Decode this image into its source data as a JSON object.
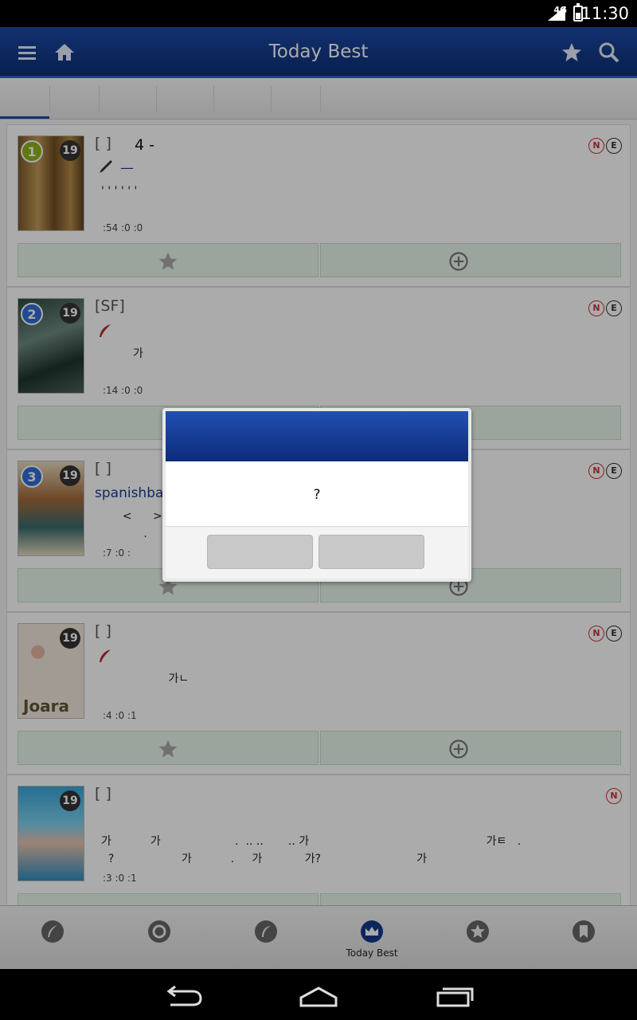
{
  "status_bar": {
    "network": "4G",
    "time": "11:30"
  },
  "app_bar": {
    "title": "Today Best"
  },
  "dialog": {
    "title": "",
    "message": "?",
    "ok_label": "",
    "cancel_label": ""
  },
  "items": [
    {
      "rank": "1",
      "age": "19",
      "genre": "[ ]",
      "title": "4 -",
      "author": "—",
      "desc": "' ' ' ' ' '",
      "stats": ":54    :0    :0",
      "badges": [
        "N",
        "E"
      ],
      "rank_color": "#8fb317"
    },
    {
      "rank": "2",
      "age": "19",
      "genre": "[SF]",
      "title": "",
      "author": "",
      "desc": "         가",
      "stats": ":14    :0    :0",
      "badges": [
        "N",
        "E"
      ],
      "rank_color": "#2f6fd8"
    },
    {
      "rank": "3",
      "age": "19",
      "genre": "[ ]",
      "title": "",
      "author": "spanishbar",
      "desc": "      <      >                                                              .        가\n            .",
      "stats": ":7    :0    :",
      "badges": [
        "N",
        "E"
      ],
      "rank_color": "#2f6fd8"
    },
    {
      "rank": "",
      "age": "19",
      "genre": "[ ]",
      "title": "",
      "author": "",
      "desc": "                   가ㄴ",
      "stats": ":4    :0    :1",
      "badges": [
        "N",
        "E"
      ],
      "rank_color": ""
    },
    {
      "rank": "",
      "age": "19",
      "genre": "[ ]",
      "title": "",
      "author": "",
      "desc": "가           가                     .  .. ..       .. 가                                                  가ㅌ   .\n  ?                   가           .     가            가?                           가",
      "stats": ":3    :0    :1",
      "badges": [
        "N"
      ],
      "rank_color": ""
    }
  ],
  "bottom_nav": {
    "active_label": "Today Best"
  },
  "colors": {
    "primary": "#123a8a",
    "accent": "#2d5fc4",
    "action_bg": "#e9f5ec"
  }
}
